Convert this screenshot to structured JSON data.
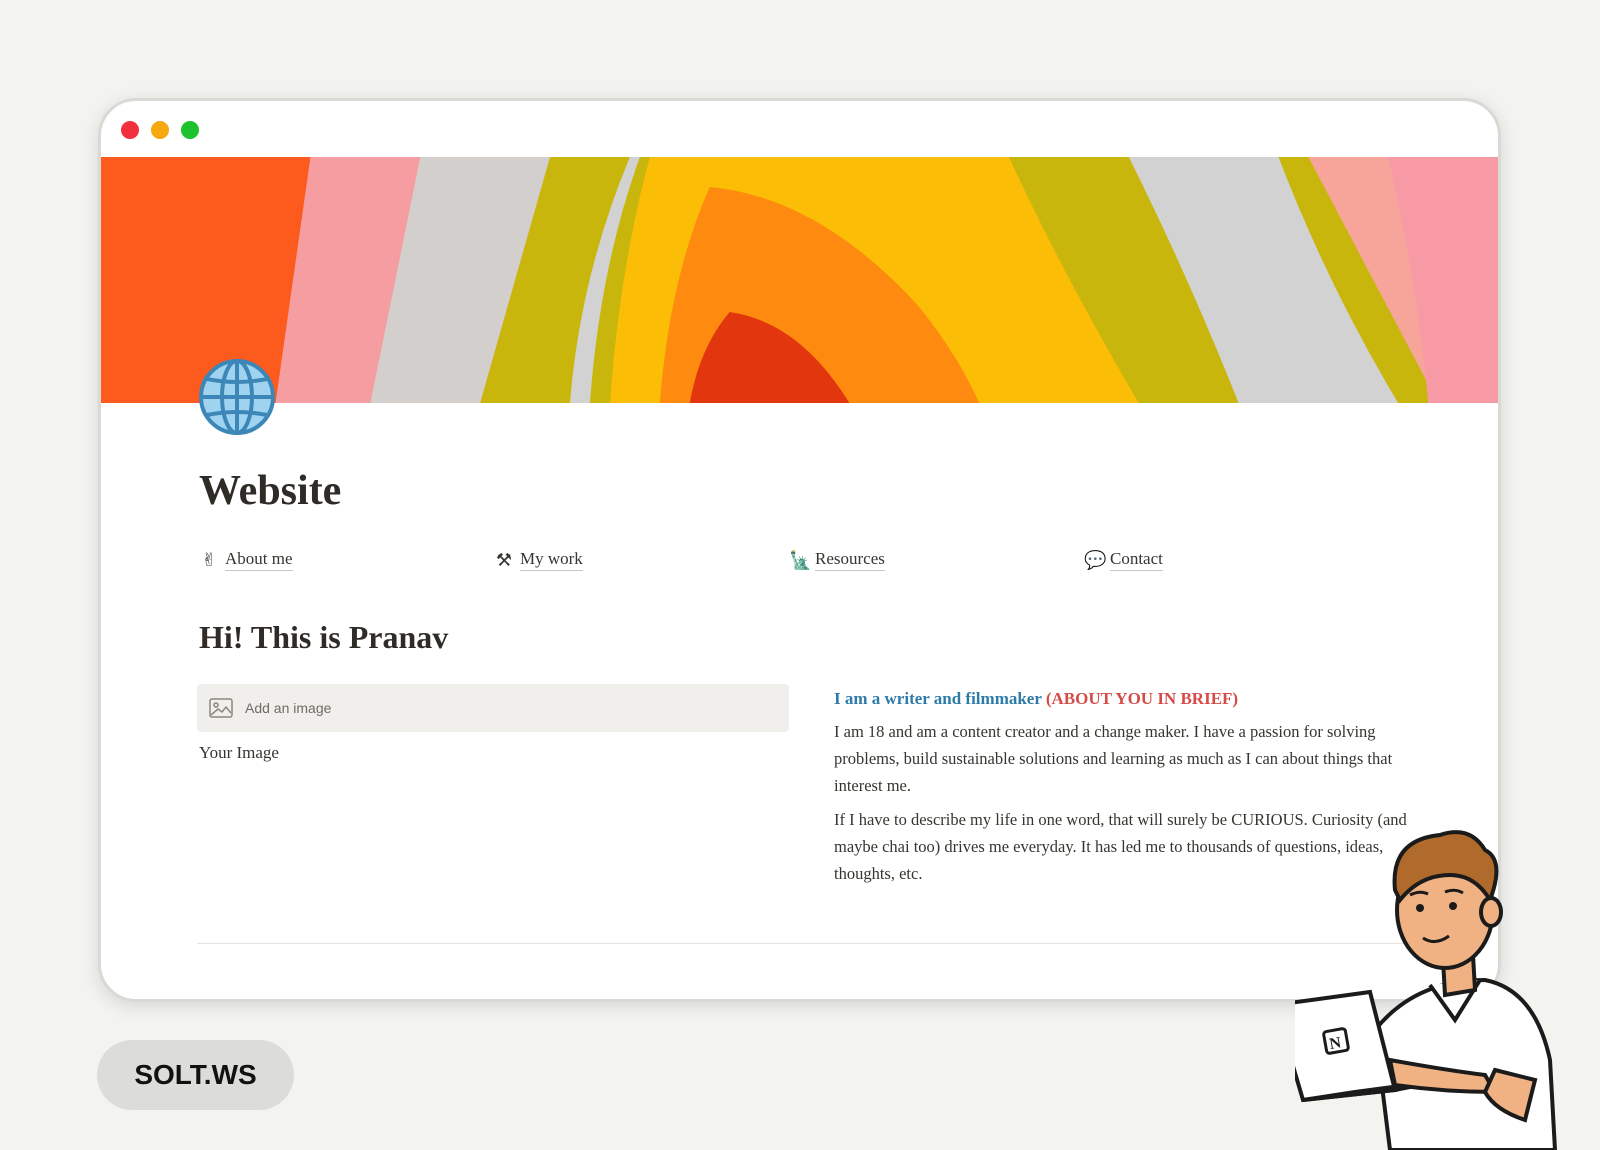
{
  "window": {
    "controls": [
      "close",
      "minimize",
      "maximize"
    ],
    "colors": {
      "close": "#f2303d",
      "minimize": "#f6a90f",
      "maximize": "#1dc22c"
    }
  },
  "page": {
    "icon": "globe-icon",
    "title": "Website"
  },
  "nav": [
    {
      "emoji": "✌",
      "icon": "victory-hand-icon",
      "label": "About me"
    },
    {
      "emoji": "⚒",
      "icon": "hammer-wrench-icon",
      "label": "My work"
    },
    {
      "emoji": "🗽",
      "icon": "statue-of-liberty-icon",
      "label": "Resources"
    },
    {
      "emoji": "💬",
      "icon": "speech-bubble-icon",
      "label": "Contact"
    }
  ],
  "intro": {
    "heading": "Hi! This is Pranav",
    "image_placeholder": "Add an image",
    "image_caption": "Your Image",
    "tagline_blue": "I am a writer and filmmaker",
    "tagline_red": "(ABOUT YOU IN BRIEF)",
    "paragraph1": "I am 18 and am a content creator and a change maker. I have a passion for solving problems, build sustainable solutions and learning as much as I can about things that interest me.",
    "paragraph2": "If I have to describe my life in one word, that will surely be CURIOUS. Curiosity (and maybe chai too) drives me everyday. It has led me to thousands of questions, ideas, thoughts, etc."
  },
  "brand": {
    "label": "SOLT.WS"
  },
  "colors": {
    "background": "#f3f3f0",
    "tagline_blue": "#2f7ba8",
    "tagline_red": "#d44c47",
    "text": "#37352f"
  }
}
